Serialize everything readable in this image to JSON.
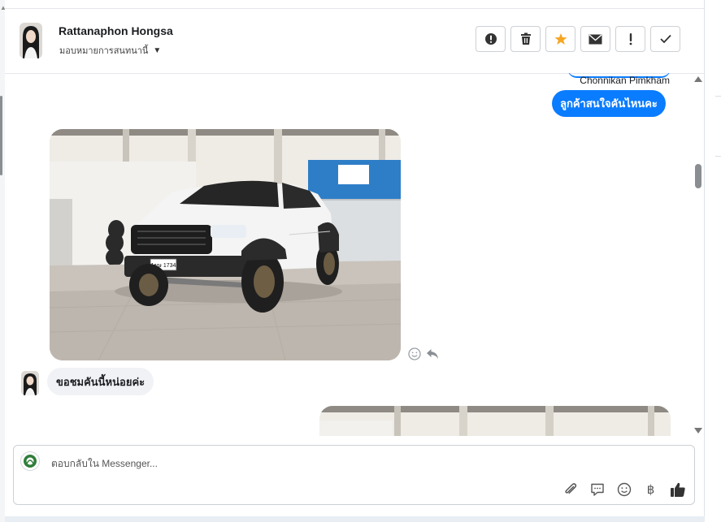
{
  "header": {
    "contact_name": "Rattanaphon Hongsa",
    "assign_label": "มอบหมายการสนทนานี้",
    "actions": [
      {
        "icon": "alert-circle-icon",
        "name": "mark-spam-button"
      },
      {
        "icon": "trash-icon",
        "name": "delete-button"
      },
      {
        "icon": "star-icon",
        "name": "star-button"
      },
      {
        "icon": "envelope-icon",
        "name": "mark-unread-button"
      },
      {
        "icon": "exclamation-icon",
        "name": "follow-up-button"
      },
      {
        "icon": "check-icon",
        "name": "mark-done-button"
      }
    ]
  },
  "messages": {
    "sender_label": "Chonnikan Pimkham",
    "outgoing_text": "ลูกค้าสนใจคันไหนคะ",
    "incoming_text": "ขอชมคันนี้หน่อยค่ะ",
    "plate_text": "1ขษ 1734"
  },
  "composer": {
    "placeholder": "ตอบกลับใน Messenger...",
    "tools": [
      "paperclip-icon",
      "saved-reply-icon",
      "emoji-icon",
      "baht-icon",
      "thumbs-up-icon"
    ],
    "baht_symbol": "฿"
  },
  "colors": {
    "accent": "#0a7cff",
    "star": "#f5a623",
    "incoming_bubble": "#f0f2f5"
  }
}
